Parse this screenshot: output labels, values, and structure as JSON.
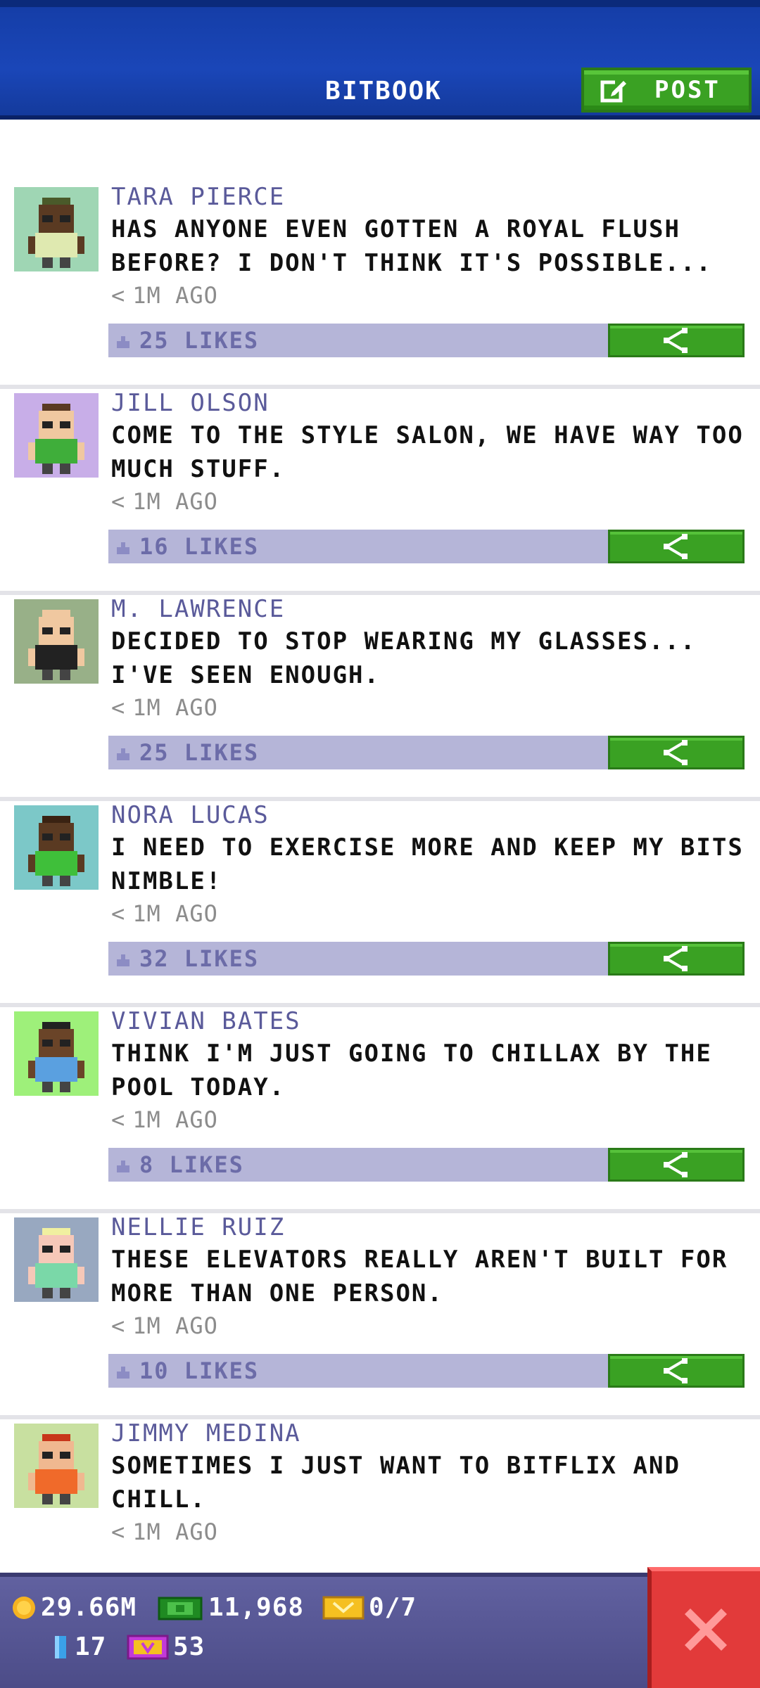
{
  "header": {
    "title": "BITBOOK",
    "post_label": "POST"
  },
  "posts": [
    {
      "author": "TARA PIERCE",
      "message": "HAS ANYONE EVEN GOTTEN A ROYAL FLUSH BEFORE? I DON'T THINK IT'S POSSIBLE...",
      "time": "1M AGO",
      "likes": "25 LIKES",
      "avatar_bg": "#9fd6b4",
      "skin": "#5a3a22",
      "shirt": "#dfe9b0",
      "hair": "#4a5a2a"
    },
    {
      "author": "JILL OLSON",
      "message": "COME TO THE STYLE SALON, WE HAVE WAY TOO MUCH STUFF.",
      "time": "1M AGO",
      "likes": "16 LIKES",
      "avatar_bg": "#c8aee8",
      "skin": "#f0c8a0",
      "shirt": "#3fae3a",
      "hair": "#5a3a22"
    },
    {
      "author": "M. LAWRENCE",
      "message": "DECIDED TO STOP WEARING MY GLASSES... I'VE SEEN ENOUGH.",
      "time": "1M AGO",
      "likes": "25 LIKES",
      "avatar_bg": "#98b088",
      "skin": "#f0c8a0",
      "shirt": "#222222",
      "hair": "#f0c8a0"
    },
    {
      "author": "NORA LUCAS",
      "message": "I NEED TO EXERCISE MORE AND KEEP MY BITS NIMBLE!",
      "time": "1M AGO",
      "likes": "32 LIKES",
      "avatar_bg": "#7cc8c8",
      "skin": "#5a3a22",
      "shirt": "#3fbf3a",
      "hair": "#3a2212"
    },
    {
      "author": "VIVIAN BATES",
      "message": "THINK I'M JUST GOING TO CHILLAX BY THE POOL TODAY.",
      "time": "1M AGO",
      "likes": "8 LIKES",
      "avatar_bg": "#9ef07a",
      "skin": "#6a4428",
      "shirt": "#5aa0e0",
      "hair": "#222222"
    },
    {
      "author": "NELLIE RUIZ",
      "message": "THESE ELEVATORS REALLY AREN'T BUILT FOR MORE THAN ONE PERSON.",
      "time": "1M AGO",
      "likes": "10 LIKES",
      "avatar_bg": "#98a8c0",
      "skin": "#f6c8b8",
      "shirt": "#7ad8a8",
      "hair": "#f0f0a0"
    },
    {
      "author": "JIMMY MEDINA",
      "message": "SOMETIMES I JUST WANT TO BITFLIX AND CHILL.",
      "time": "1M AGO",
      "likes": "",
      "avatar_bg": "#c8e0a0",
      "skin": "#f0b890",
      "shirt": "#f06a2a",
      "hair": "#c8361a"
    }
  ],
  "stats": {
    "coins": "29.66M",
    "bux": "11,968",
    "tickets": "0/7",
    "gems": "17",
    "vip": "53"
  },
  "colors": {
    "header_blue": "#1a46b8",
    "accent_green": "#3aa123",
    "likes_bar": "#b5b5d8",
    "author_text": "#5a5a9a",
    "close_red": "#e23a3a"
  },
  "icons": {
    "post": "edit-icon",
    "share": "share-icon",
    "like": "thumb-icon",
    "close": "close-icon"
  }
}
